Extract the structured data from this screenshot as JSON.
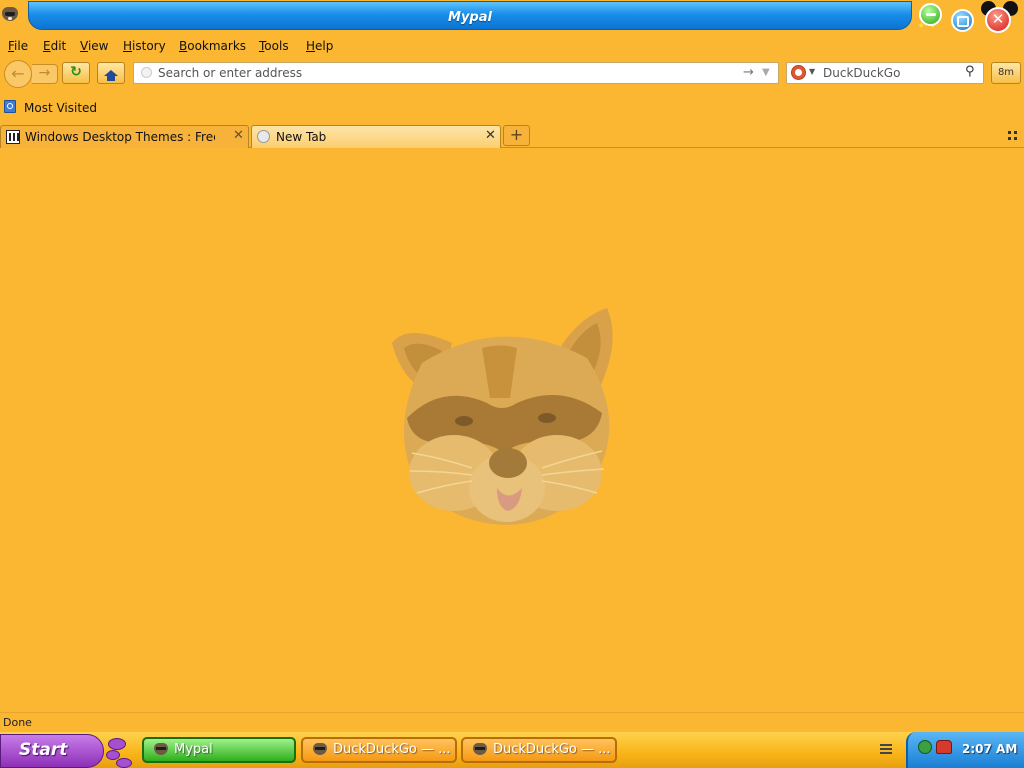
{
  "window": {
    "title": "Mypal"
  },
  "menu": {
    "items": [
      {
        "label": "File",
        "key": "F",
        "rest": "ile"
      },
      {
        "label": "Edit",
        "key": "E",
        "rest": "dit"
      },
      {
        "label": "View",
        "key": "V",
        "rest": "iew"
      },
      {
        "label": "History",
        "key": "H",
        "rest": "istory"
      },
      {
        "label": "Bookmarks",
        "key": "B",
        "rest": "ookmarks"
      },
      {
        "label": "Tools",
        "key": "T",
        "rest": "ools"
      },
      {
        "label": "Help",
        "key": "H",
        "rest": "elp"
      }
    ]
  },
  "toolbar": {
    "back_icon": "back-arrow-icon",
    "forward_icon": "forward-arrow-icon",
    "reload_icon": "reload-icon",
    "home_icon": "home-icon",
    "address_placeholder": "Search or enter address",
    "address_value": "",
    "search_engine": "DuckDuckGo",
    "search_placeholder": "DuckDuckGo",
    "gmail_label": "8m"
  },
  "bookmarks": {
    "most_visited": "Most Visited"
  },
  "tabs": [
    {
      "title": "Windows Desktop Themes : Free ...",
      "active": false
    },
    {
      "title": "New Tab",
      "active": true
    }
  ],
  "content": {
    "logo": "raccoon-face-logo"
  },
  "status": {
    "text": "Done"
  },
  "taskbar": {
    "start_label": "Start",
    "tasks": [
      {
        "label": "Mypal",
        "active": true
      },
      {
        "label": "DuckDuckGo — ...",
        "active": false
      },
      {
        "label": "DuckDuckGo — ...",
        "active": false
      }
    ],
    "clock": "2:07 AM"
  },
  "colors": {
    "background": "#fbb632",
    "titlebar": "#1a8ee8",
    "start_button": "#9b3fc6",
    "active_task": "#2fae1d",
    "tray": "#1a7fd4"
  }
}
